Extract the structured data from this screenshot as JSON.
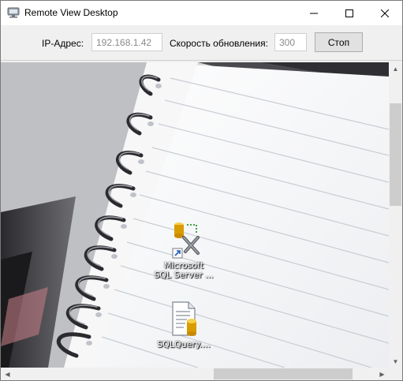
{
  "window": {
    "title": "Remote View Desktop",
    "controls": {
      "minimize": "minimize",
      "maximize": "maximize",
      "close": "close"
    }
  },
  "toolbar": {
    "ip_label": "IP-Адрес:",
    "ip_value": "192.168.1.42",
    "speed_label": "Скорость обновления:",
    "speed_value": "300",
    "stop_label": "Стоп"
  },
  "desktop": {
    "icons": [
      {
        "label_line1": "Microsoft",
        "label_line2": "SQL Server ...",
        "icon": "sql-server-tools-icon"
      },
      {
        "label_line1": "SQLQuery....",
        "icon": "sql-query-file-icon"
      }
    ],
    "wallpaper": "spiral-notebook"
  },
  "colors": {
    "titlebar": "#ffffff",
    "window_bg": "#f0f0f0",
    "scroll_thumb": "#cdcdcd"
  }
}
